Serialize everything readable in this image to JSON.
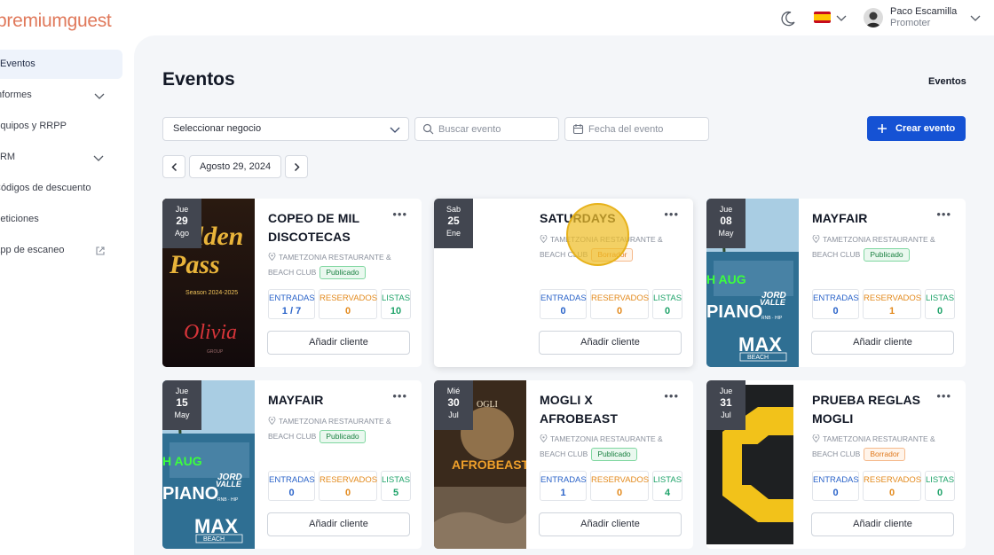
{
  "brand": {
    "logo_text": "premiumguest",
    "color": "#e0795b"
  },
  "header": {
    "language_flag": "spain-flag",
    "user": {
      "name": "Paco Escamilla",
      "role": "Promoter"
    }
  },
  "sidebar": {
    "items": [
      {
        "label": "Eventos",
        "active": true
      },
      {
        "label": "Informes",
        "expandable": true
      },
      {
        "label": "Equipos y RRPP"
      },
      {
        "label": "CRM",
        "expandable": true
      },
      {
        "label": "Códigos de descuento"
      },
      {
        "label": "Peticiones"
      },
      {
        "label": "App de escaneo",
        "external": true
      }
    ]
  },
  "page": {
    "title": "Eventos",
    "breadcrumb": "Eventos",
    "business_select": "Seleccionar negocio",
    "search_placeholder": "Buscar evento",
    "date_placeholder": "Fecha del evento",
    "create_button": "Crear evento",
    "current_date": "Agosto 29, 2024",
    "accent": "#1552d4"
  },
  "card_labels": {
    "entradas": "ENTRADAS",
    "reservados": "RESERVADOS",
    "listas": "LISTAS",
    "add_client": "Añadir cliente"
  },
  "events": [
    {
      "dow": "Jue",
      "day": "29",
      "month": "Ago",
      "title": "COPEO DE MIL DISCOTECAS",
      "location": "TAMETZONIA RESTAURANTE & BEACH CLUB",
      "status": "Publicado",
      "entradas": "1 / 7",
      "reservados": "0",
      "listas": "10",
      "poster": "golden-pass"
    },
    {
      "dow": "Sab",
      "day": "25",
      "month": "Ene",
      "title": "SATURDAYS",
      "location": "TAMETZONIA RESTAURANTE & BEACH CLUB",
      "status": "Borrador",
      "entradas": "0",
      "reservados": "0",
      "listas": "0",
      "poster": "blank"
    },
    {
      "dow": "Jue",
      "day": "08",
      "month": "May",
      "title": "MAYFAIR",
      "location": "TAMETZONIA RESTAURANTE & BEACH CLUB",
      "status": "Publicado",
      "entradas": "0",
      "reservados": "1",
      "listas": "0",
      "poster": "max-beach"
    },
    {
      "dow": "Jue",
      "day": "15",
      "month": "May",
      "title": "MAYFAIR",
      "location": "TAMETZONIA RESTAURANTE & BEACH CLUB",
      "status": "Publicado",
      "entradas": "0",
      "reservados": "0",
      "listas": "5",
      "poster": "max-beach"
    },
    {
      "dow": "Mié",
      "day": "30",
      "month": "Jul",
      "title": "MOGLI X AFROBEAST",
      "location": "TAMETZONIA RESTAURANTE & BEACH CLUB",
      "status": "Publicado",
      "entradas": "1",
      "reservados": "0",
      "listas": "4",
      "poster": "afrobeast"
    },
    {
      "dow": "Jue",
      "day": "31",
      "month": "Jul",
      "title": "PRUEBA REGLAS MOGLI",
      "location": "TAMETZONIA RESTAURANTE & BEACH CLUB",
      "status": "Borrador",
      "entradas": "0",
      "reservados": "0",
      "listas": "0",
      "poster": "yellow-c"
    }
  ]
}
